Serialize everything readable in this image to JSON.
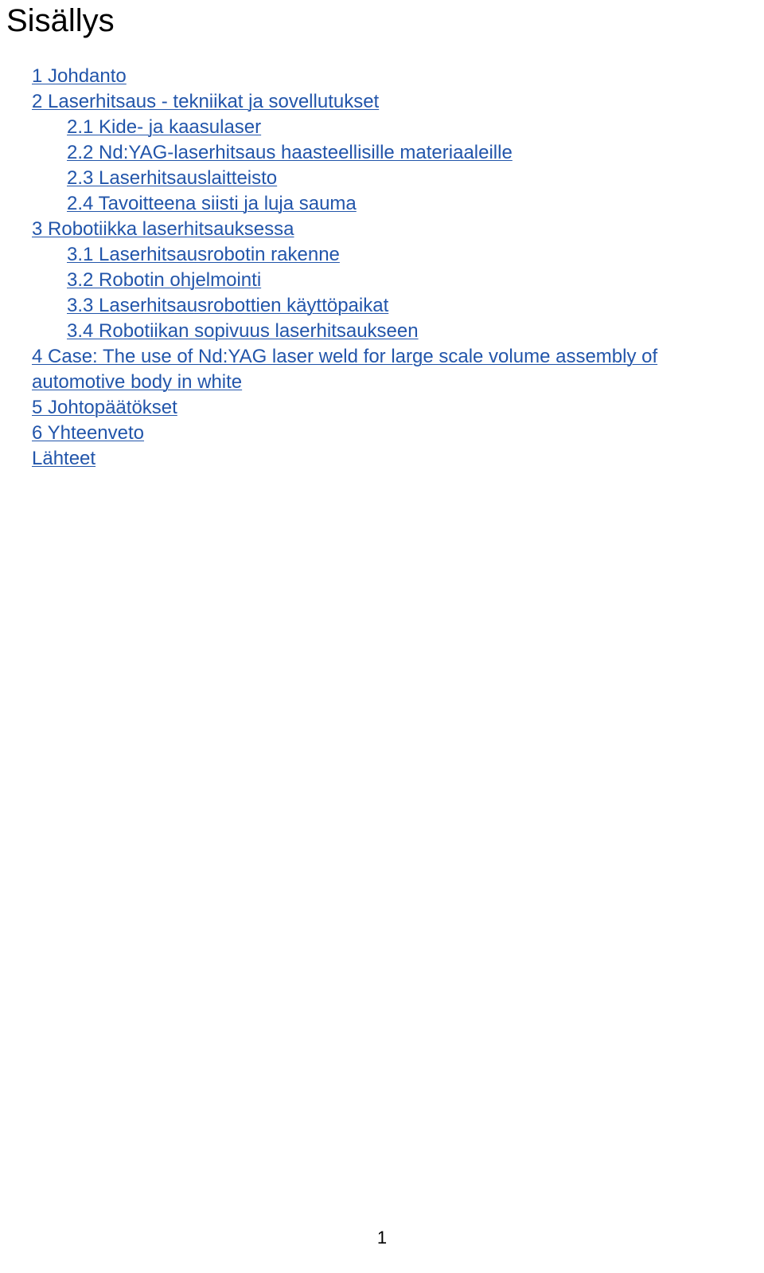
{
  "document": {
    "title": "Sisällys",
    "page_number": "1",
    "link_color": "#2255aa",
    "text_color": "#000000",
    "background_color": "#ffffff"
  },
  "toc": {
    "entries": [
      {
        "label": "1 Johdanto",
        "level": 1
      },
      {
        "label": "2 Laserhitsaus - tekniikat ja sovellutukset",
        "level": 1
      },
      {
        "label": "2.1 Kide- ja kaasulaser",
        "level": 2
      },
      {
        "label": "2.2 Nd:YAG-laserhitsaus haasteellisille materiaaleille",
        "level": 2
      },
      {
        "label": "2.3 Laserhitsauslaitteisto",
        "level": 2
      },
      {
        "label": "2.4 Tavoitteena siisti ja luja sauma",
        "level": 2
      },
      {
        "label": "3 Robotiikka laserhitsauksessa",
        "level": 1
      },
      {
        "label": "3.1 Laserhitsausrobotin rakenne",
        "level": 2
      },
      {
        "label": "3.2 Robotin ohjelmointi",
        "level": 2
      },
      {
        "label": "3.3 Laserhitsausrobottien käyttöpaikat",
        "level": 2
      },
      {
        "label": "3.4 Robotiikan sopivuus laserhitsaukseen",
        "level": 2
      },
      {
        "label": "4 Case: The use of Nd:YAG laser weld for large scale volume assembly of automotive body in white",
        "level": 1
      },
      {
        "label": "5 Johtopäätökset",
        "level": 1
      },
      {
        "label": "6 Yhteenveto",
        "level": 1
      },
      {
        "label": "Lähteet",
        "level": 1
      }
    ]
  }
}
